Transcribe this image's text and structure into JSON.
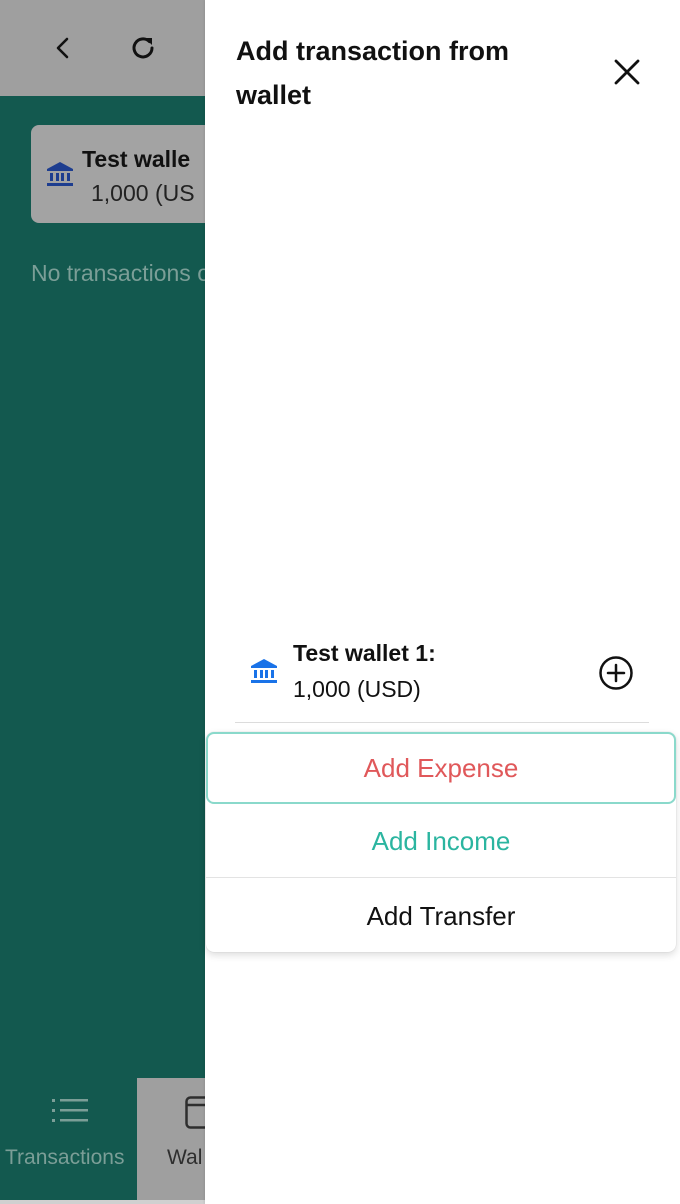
{
  "app": {
    "wallet_card": {
      "name": "Test walle",
      "amount": "1,000 (US"
    },
    "empty_message": "No transactions one!",
    "nav": {
      "transactions_label": "Transactions",
      "wallets_label": "Wal"
    }
  },
  "drawer": {
    "title": "Add transaction from wallet",
    "wallet": {
      "name": "Test wallet 1:",
      "amount": "1,000 (USD)"
    },
    "menu": {
      "expense_label": "Add Expense",
      "income_label": "Add Income",
      "transfer_label": "Add Transfer"
    }
  },
  "icons": {
    "back": "chevron-left-icon",
    "refresh": "refresh-icon",
    "bank": "bank-icon",
    "close": "close-icon",
    "add": "plus-circle-icon",
    "list": "list-icon",
    "wallet": "wallet-icon"
  },
  "colors": {
    "app_background": "#13594f",
    "bar_background": "#9f9f9f",
    "expense": "#e0585a",
    "income": "#2bb5a0",
    "bank_icon": "#1a73e8",
    "focus_border": "#8ad9cb"
  }
}
